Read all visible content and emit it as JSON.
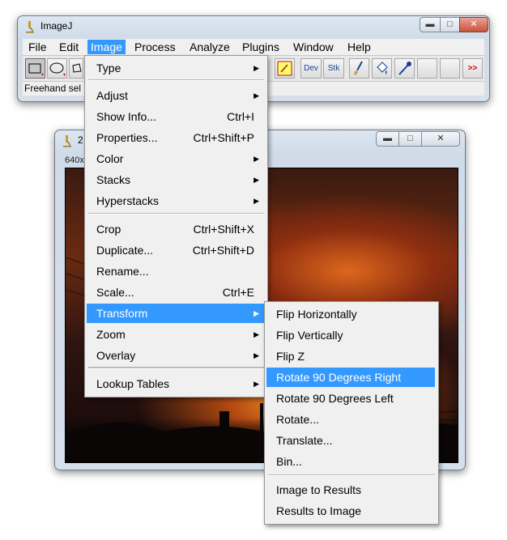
{
  "main_window": {
    "title": "ImageJ",
    "menubar": [
      "File",
      "Edit",
      "Image",
      "Process",
      "Analyze",
      "Plugins",
      "Window",
      "Help"
    ],
    "toolbar": {
      "dev_label": "Dev",
      "stk_label": "Stk",
      "more_label": ">>"
    },
    "status_text": "Freehand sel"
  },
  "image_window": {
    "title": "2",
    "info": "640x"
  },
  "image_menu": {
    "items": [
      {
        "label": "Type",
        "shortcut": "",
        "submenu": true
      },
      {
        "label": "Adjust",
        "shortcut": "",
        "submenu": true
      },
      {
        "label": "Show Info...",
        "shortcut": "Ctrl+I",
        "submenu": false
      },
      {
        "label": "Properties...",
        "shortcut": "Ctrl+Shift+P",
        "submenu": false
      },
      {
        "label": "Color",
        "shortcut": "",
        "submenu": true
      },
      {
        "label": "Stacks",
        "shortcut": "",
        "submenu": true
      },
      {
        "label": "Hyperstacks",
        "shortcut": "",
        "submenu": true
      },
      {
        "label": "Crop",
        "shortcut": "Ctrl+Shift+X",
        "submenu": false
      },
      {
        "label": "Duplicate...",
        "shortcut": "Ctrl+Shift+D",
        "submenu": false
      },
      {
        "label": "Rename...",
        "shortcut": "",
        "submenu": false
      },
      {
        "label": "Scale...",
        "shortcut": "Ctrl+E",
        "submenu": false
      },
      {
        "label": "Transform",
        "shortcut": "",
        "submenu": true
      },
      {
        "label": "Zoom",
        "shortcut": "",
        "submenu": true
      },
      {
        "label": "Overlay",
        "shortcut": "",
        "submenu": true
      },
      {
        "label": "Lookup Tables",
        "shortcut": "",
        "submenu": true
      }
    ]
  },
  "transform_menu": {
    "items": [
      {
        "label": "Flip Horizontally"
      },
      {
        "label": "Flip Vertically"
      },
      {
        "label": "Flip Z"
      },
      {
        "label": "Rotate 90 Degrees Right"
      },
      {
        "label": "Rotate 90 Degrees Left"
      },
      {
        "label": "Rotate..."
      },
      {
        "label": "Translate..."
      },
      {
        "label": "Bin..."
      },
      {
        "label": "Image to Results"
      },
      {
        "label": "Results to Image"
      }
    ]
  },
  "colors": {
    "highlight": "#3399ff",
    "menu_bg": "#f0f0f0",
    "close_button": "#c9533c"
  }
}
